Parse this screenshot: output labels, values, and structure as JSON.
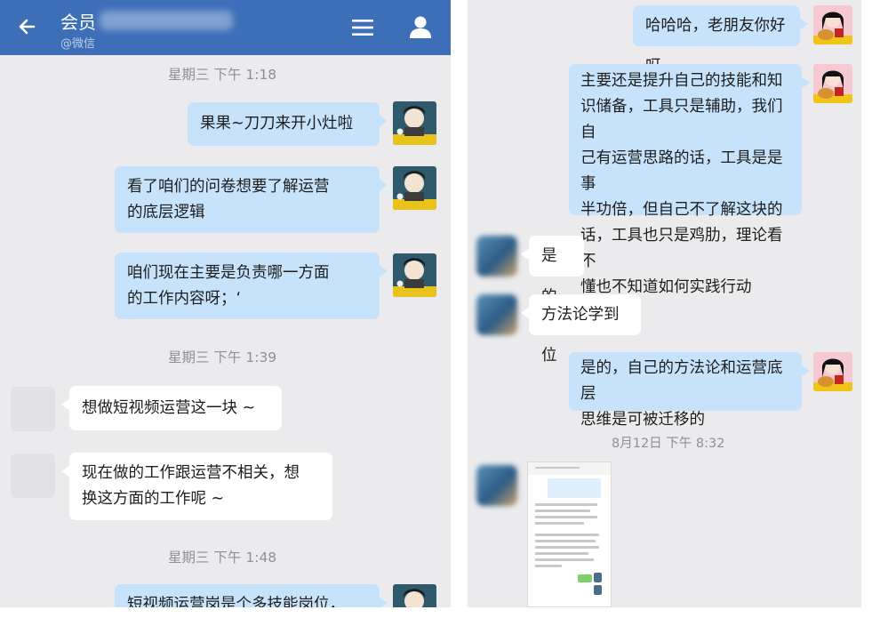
{
  "left_chat": {
    "header": {
      "title": "会员",
      "subtitle": "@微信"
    },
    "timestamps": [
      "星期三  下午 1:18",
      "星期三  下午 1:39",
      "星期三  下午 1:48"
    ],
    "messages": [
      {
        "side": "right",
        "text": "果果~刀刀来开小灶啦"
      },
      {
        "side": "right",
        "lines": [
          "看了咱们的问卷想要了解运营",
          "的底层逻辑"
        ]
      },
      {
        "side": "right",
        "lines": [
          "咱们现在主要是负责哪一方面",
          "的工作内容呀；‘"
        ]
      },
      {
        "side": "left",
        "text": "想做短视频运营这一块 ~"
      },
      {
        "side": "left",
        "lines": [
          "现在做的工作跟运营不相关，想",
          "换这方面的工作呢 ~"
        ]
      },
      {
        "side": "right",
        "text": "短视频运营岗是个多技能岗位，"
      }
    ]
  },
  "right_chat": {
    "timestamp": "8月12日  下午 8:32",
    "messages": [
      {
        "side": "right",
        "text": "哈哈哈，老朋友你好呀"
      },
      {
        "side": "right",
        "lines": [
          "主要还是提升自己的技能和知",
          "识储备，工具只是辅助，我们自",
          "己有运营思路的话，工具是是事",
          "半功倍，但自己不了解这块的",
          "话，工具也只是鸡肋，理论看不",
          "懂也不知道如何实践行动"
        ]
      },
      {
        "side": "left",
        "text": "是的"
      },
      {
        "side": "left",
        "text": "方法论学到位"
      },
      {
        "side": "right",
        "lines": [
          "是的，自己的方法论和运营底层",
          "思维是可被迁移的"
        ]
      },
      {
        "side": "left",
        "type": "image"
      }
    ]
  },
  "colors": {
    "header": "#3d6fb9",
    "bubble_mine": "#c7e2fb",
    "bubble_theirs": "#ffffff",
    "background": "#ebebed"
  },
  "icons": [
    "back-arrow-icon",
    "menu-icon",
    "profile-icon"
  ]
}
